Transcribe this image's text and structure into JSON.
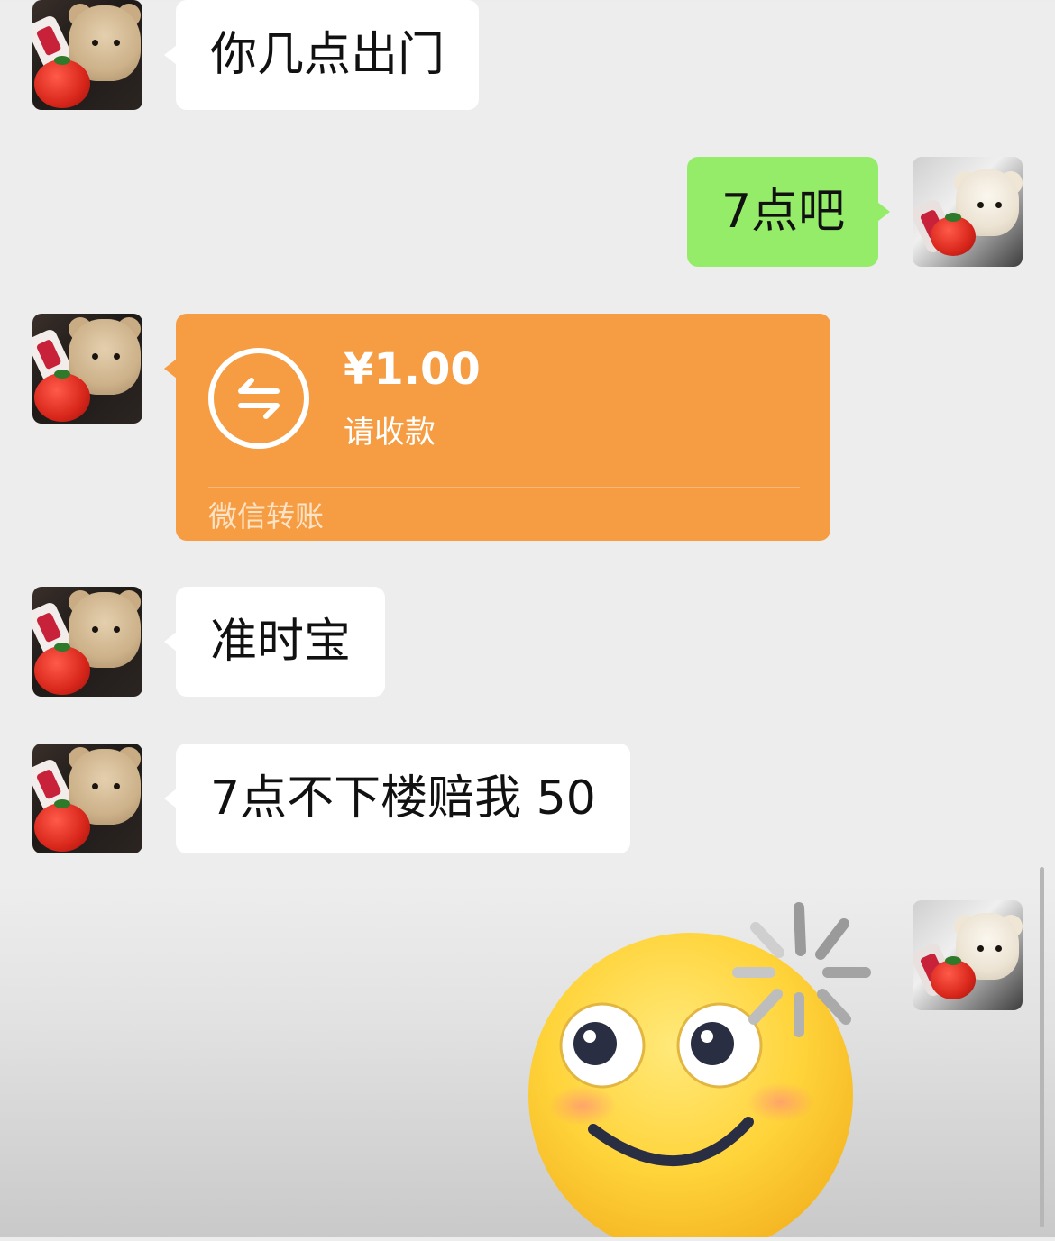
{
  "messages": [
    {
      "side": "left",
      "type": "text",
      "text": "你几点出门"
    },
    {
      "side": "right",
      "type": "text",
      "text": "7点吧"
    },
    {
      "side": "left",
      "type": "transfer",
      "amount": "¥1.00",
      "note": "请收款",
      "footer": "微信转账",
      "icon": "transfer-arrows-icon"
    },
    {
      "side": "left",
      "type": "text",
      "text": "准时宝"
    },
    {
      "side": "left",
      "type": "text",
      "text": "7点不下楼赔我 50"
    },
    {
      "side": "right",
      "type": "sticker",
      "icon": "smiley-sticker-icon"
    }
  ],
  "colors": {
    "background": "#ededed",
    "incoming_bubble": "#ffffff",
    "outgoing_bubble": "#95ec69",
    "transfer_card": "#f69d43"
  }
}
